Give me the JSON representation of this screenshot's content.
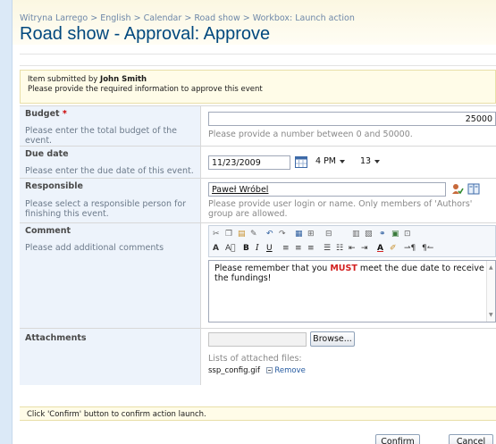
{
  "breadcrumb": {
    "items": [
      "Witryna Larrego",
      "English",
      "Calendar",
      "Road show",
      "Workbox: Launch action"
    ],
    "separator": ">"
  },
  "title": "Road show - Approval: Approve",
  "info": {
    "submitted_prefix": "Item submitted by",
    "submitted_by": "John Smith",
    "instruction": "Please provide the required information to approve this event"
  },
  "fields": {
    "budget": {
      "label": "Budget",
      "required_mark": "*",
      "description": "Please enter the total budget of the event.",
      "value": "25000",
      "hint": "Please provide a number between 0 and 50000."
    },
    "due_date": {
      "label": "Due date",
      "description": "Please enter the due date of this event.",
      "date": "11/23/2009",
      "hour": "4 PM",
      "minute": "13"
    },
    "responsible": {
      "label": "Responsible",
      "description": "Please select a responsible person for finishing this event.",
      "value": "Paweł Wróbel",
      "hint": "Please provide user login or name. Only members of 'Authors' group are allowed."
    },
    "comment": {
      "label": "Comment",
      "description": "Please add additional comments",
      "text_before": "Please remember that you ",
      "text_emphasis": "MUST",
      "text_after": " meet the due date to receive the fundings!"
    },
    "attachments": {
      "label": "Attachments",
      "browse_label": "Browse...",
      "list_label": "Lists of attached files:",
      "file_name": "ssp_config.gif",
      "remove_label": "Remove"
    }
  },
  "footer": {
    "instruction": "Click 'Confirm' button to confirm action launch.",
    "confirm_label": "Confirm",
    "cancel_label": "Cancel"
  },
  "colors": {
    "title": "#00487e",
    "label_column": "#edf3fb",
    "info_background": "#fffce8",
    "emphasis": "#d21f1f"
  }
}
